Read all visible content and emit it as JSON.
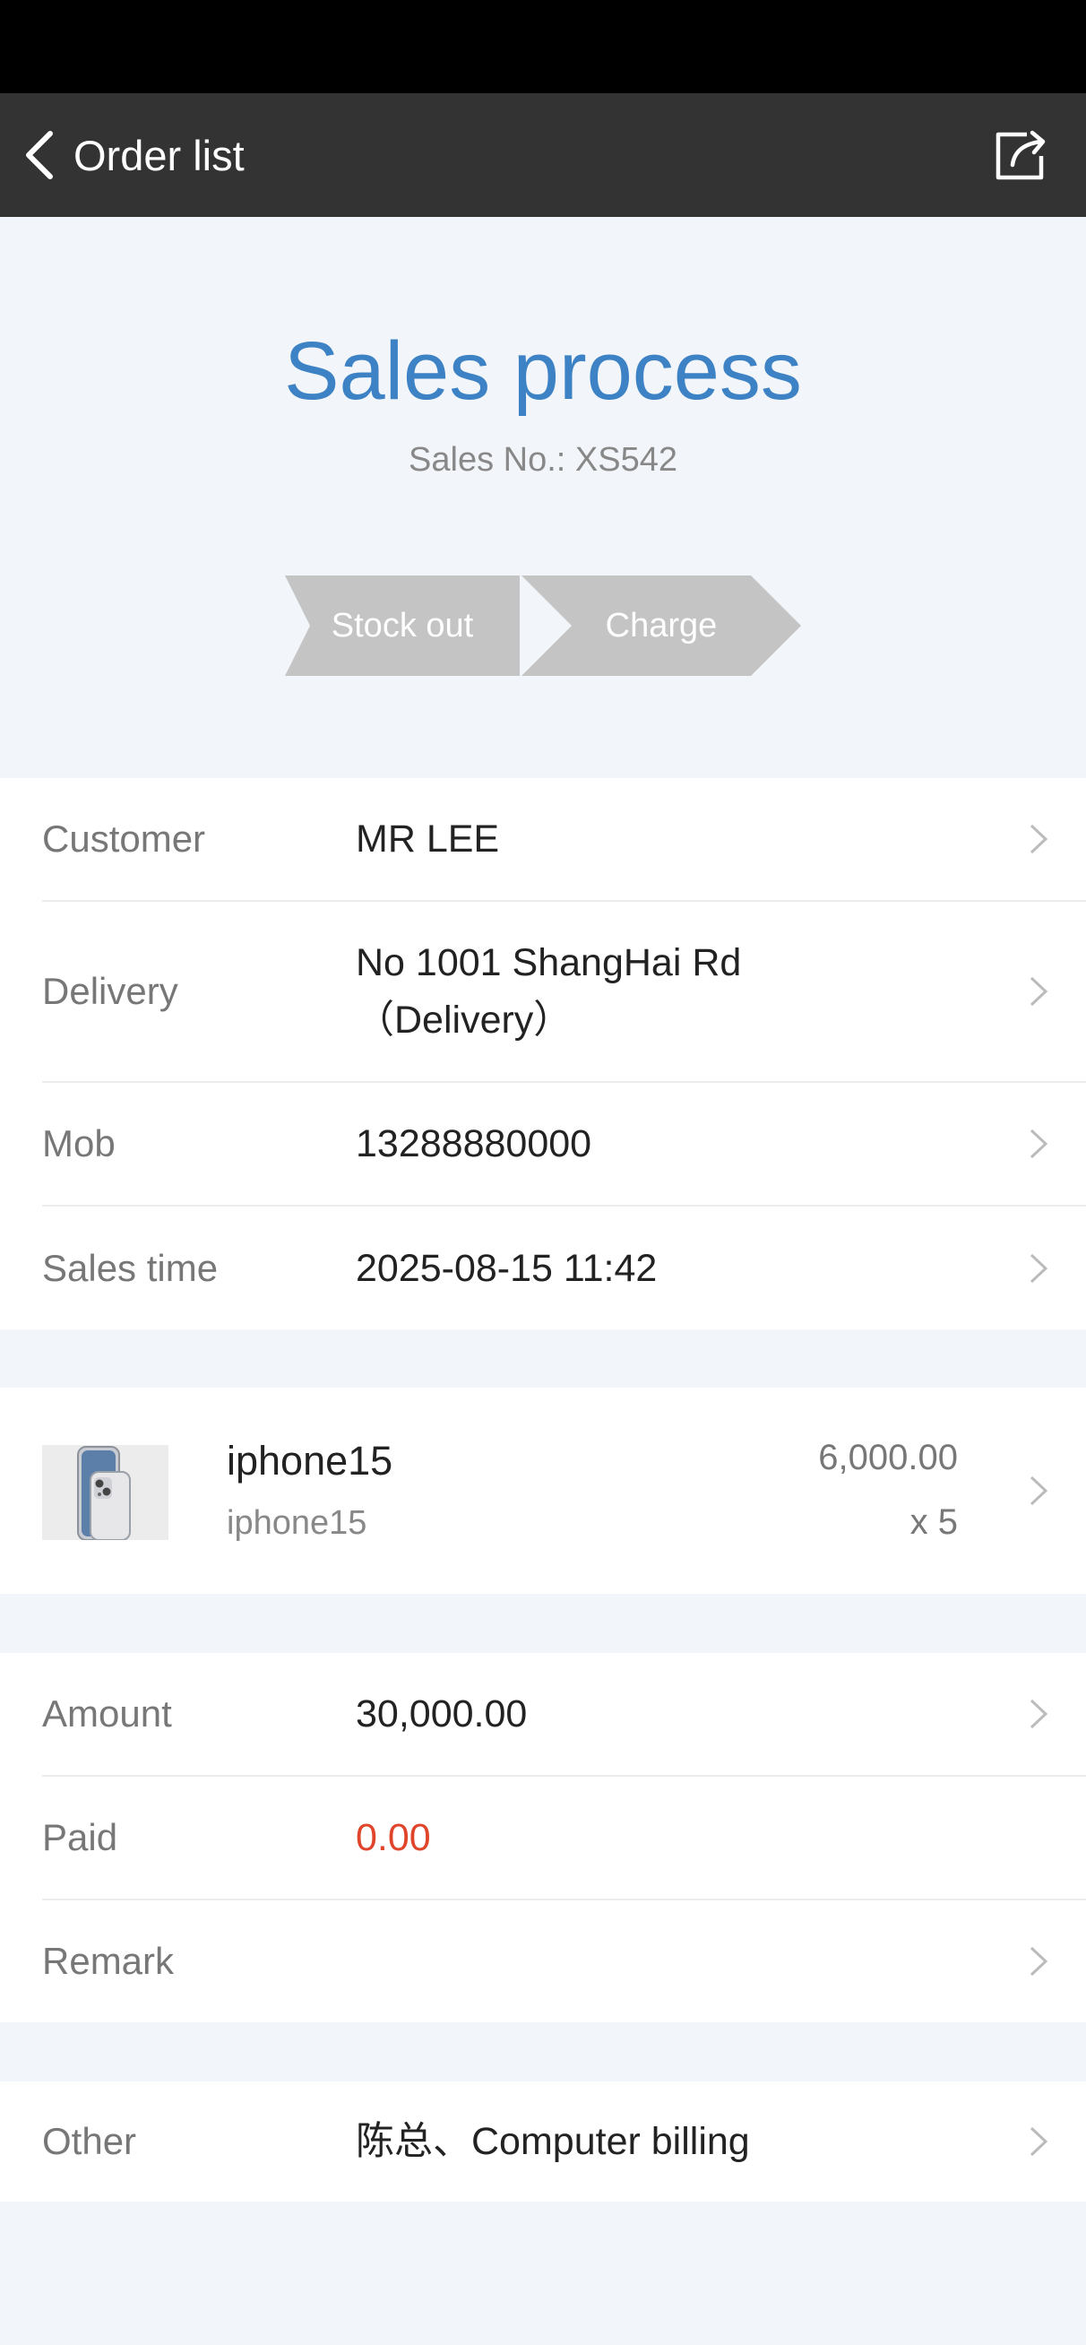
{
  "nav": {
    "title": "Order list"
  },
  "hero": {
    "title": "Sales process",
    "sales_no": "Sales No.: XS542",
    "steps": [
      "Stock out",
      "Charge"
    ]
  },
  "info": {
    "customer": {
      "label": "Customer",
      "value": "MR LEE"
    },
    "delivery": {
      "label": "Delivery",
      "value_line1": "No 1001 ShangHai Rd",
      "value_line2": "（Delivery）"
    },
    "mob": {
      "label": "Mob",
      "value": "13288880000"
    },
    "sales_time": {
      "label": "Sales time",
      "value": "2025-08-15 11:42"
    }
  },
  "product": {
    "name": "iphone15",
    "spec": "iphone15",
    "price": "6,000.00",
    "qty": "x 5"
  },
  "totals": {
    "amount": {
      "label": "Amount",
      "value": "30,000.00"
    },
    "paid": {
      "label": "Paid",
      "value": "0.00"
    },
    "remark": {
      "label": "Remark",
      "value": ""
    }
  },
  "other": {
    "label": "Other",
    "value": "陈总、Computer billing"
  },
  "colors": {
    "accent": "#3d82c4",
    "nav_bg": "#333333",
    "paid_red": "#e0442a",
    "step_gray": "#c4c4c4"
  }
}
